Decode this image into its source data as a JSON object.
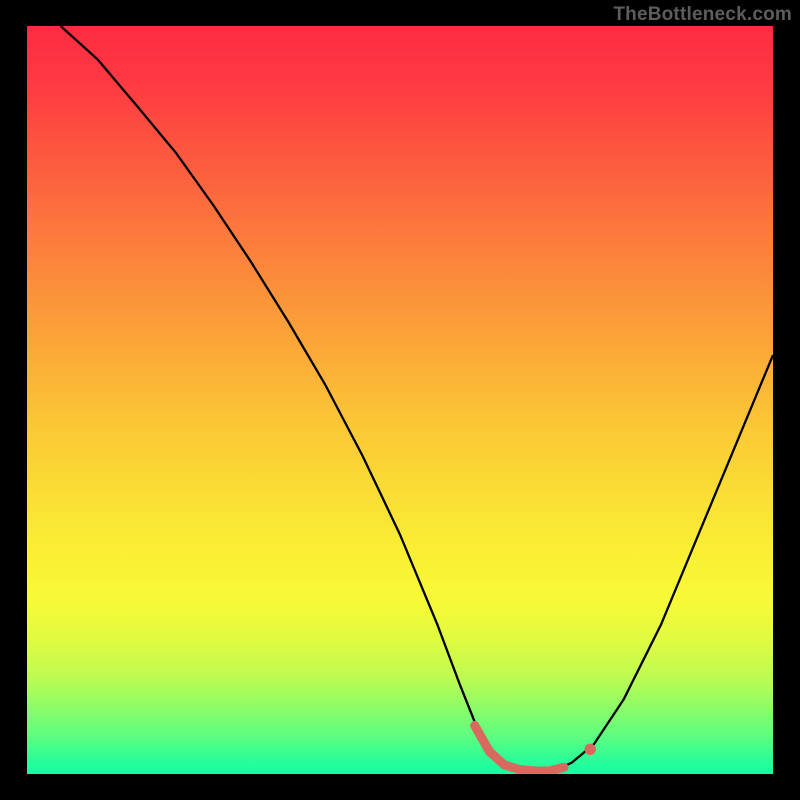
{
  "watermark": "TheBottleneck.com",
  "chart_data": {
    "type": "line",
    "title": "",
    "xlabel": "",
    "ylabel": "",
    "x_range": [
      0,
      100
    ],
    "y_range": [
      0,
      100
    ],
    "background": "vertical gradient red→orange→yellow→green (heatmap style)",
    "series": [
      {
        "name": "curve",
        "color": "#000000",
        "description": "V-shaped black curve: steep descent from top-left reaching a flat minimum near x≈68, then rising toward top-right",
        "points": [
          {
            "x": 4.5,
            "y": 100
          },
          {
            "x": 9.5,
            "y": 95.5
          },
          {
            "x": 15,
            "y": 89
          },
          {
            "x": 20,
            "y": 83
          },
          {
            "x": 25,
            "y": 76
          },
          {
            "x": 30,
            "y": 68.5
          },
          {
            "x": 35,
            "y": 60.5
          },
          {
            "x": 40,
            "y": 52
          },
          {
            "x": 45,
            "y": 42.5
          },
          {
            "x": 50,
            "y": 32
          },
          {
            "x": 55,
            "y": 20
          },
          {
            "x": 58,
            "y": 12
          },
          {
            "x": 60,
            "y": 7
          },
          {
            "x": 62,
            "y": 3
          },
          {
            "x": 64,
            "y": 1
          },
          {
            "x": 67,
            "y": 0.2
          },
          {
            "x": 70,
            "y": 0.2
          },
          {
            "x": 73,
            "y": 1.5
          },
          {
            "x": 76,
            "y": 4
          },
          {
            "x": 80,
            "y": 10
          },
          {
            "x": 85,
            "y": 20
          },
          {
            "x": 90,
            "y": 32
          },
          {
            "x": 95,
            "y": 44
          },
          {
            "x": 100,
            "y": 56
          }
        ]
      },
      {
        "name": "highlight",
        "color": "#d8695e",
        "description": "Thick salmon highlight segment overlapping the minimum region of the curve",
        "points": [
          {
            "x": 60,
            "y": 6.5
          },
          {
            "x": 62,
            "y": 3
          },
          {
            "x": 64,
            "y": 1.2
          },
          {
            "x": 66,
            "y": 0.6
          },
          {
            "x": 68,
            "y": 0.4
          },
          {
            "x": 70,
            "y": 0.4
          },
          {
            "x": 72,
            "y": 0.9
          }
        ]
      },
      {
        "name": "marker",
        "color": "#d8695e",
        "description": "Small circular marker on the curve at the end of the highlight",
        "point": {
          "x": 75.5,
          "y": 3.3
        }
      }
    ]
  }
}
